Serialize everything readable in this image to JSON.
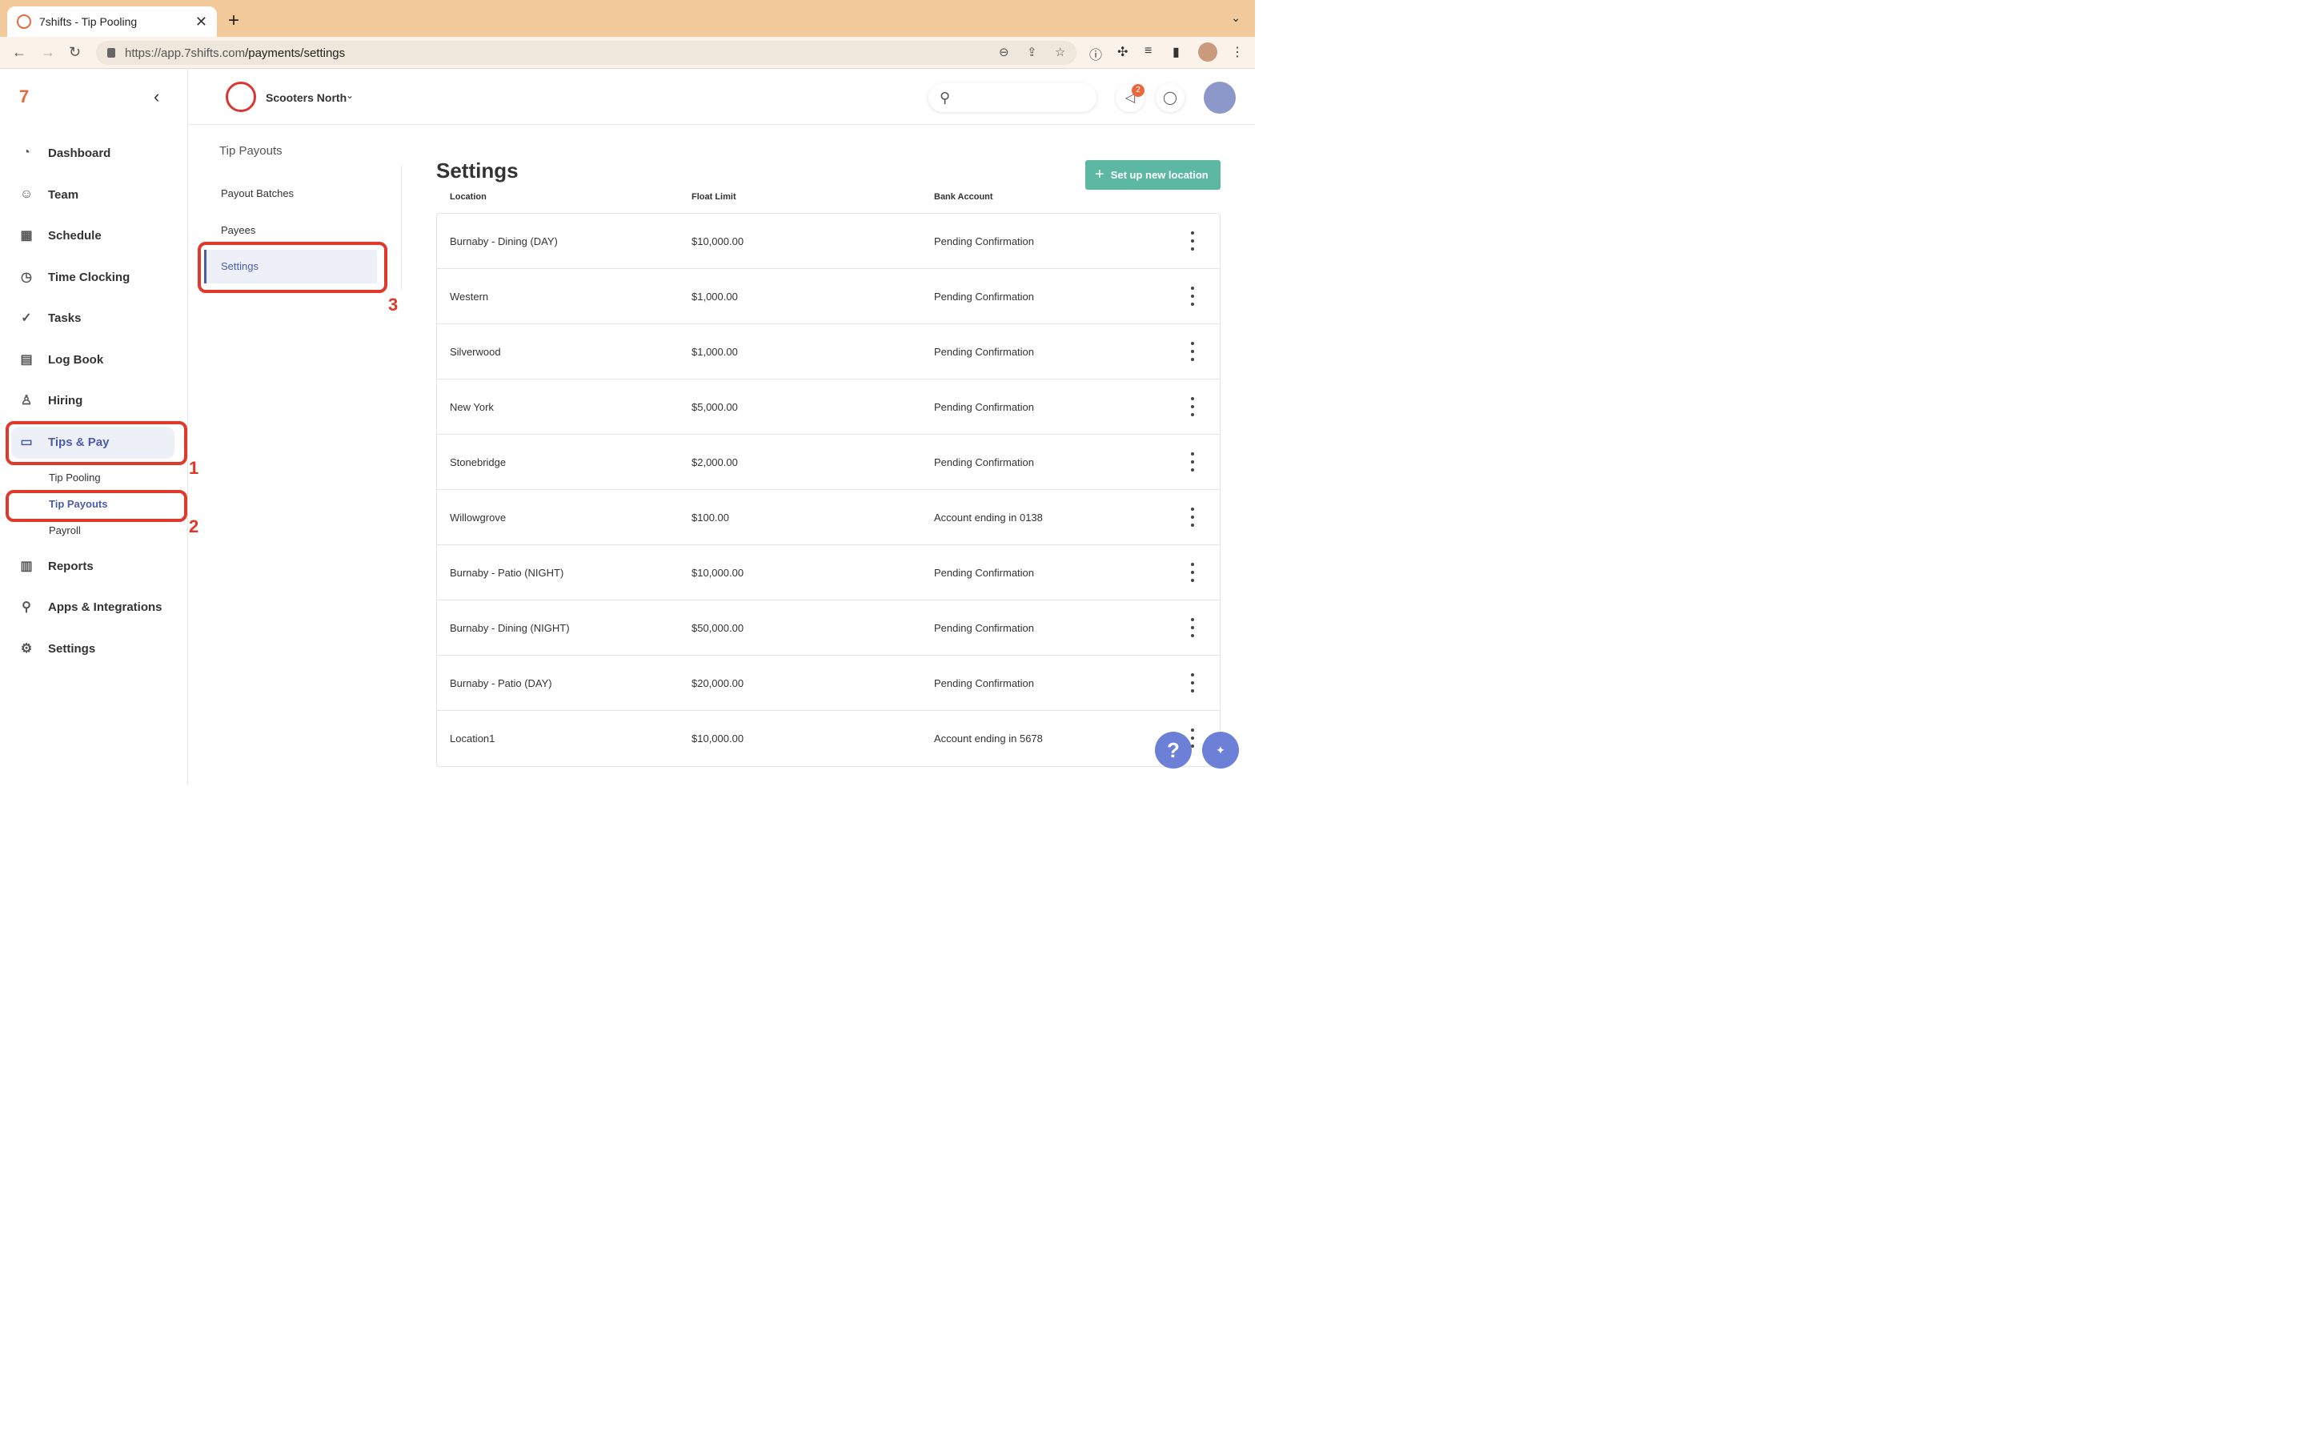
{
  "browser": {
    "tab_title": "7shifts - Tip Pooling",
    "new_tab": "+",
    "url_host": "https://app.7shifts.com",
    "url_path": "/payments/settings"
  },
  "sidebar": {
    "items": [
      {
        "label": "Dashboard",
        "icon": "dashboard-icon"
      },
      {
        "label": "Team",
        "icon": "team-icon"
      },
      {
        "label": "Schedule",
        "icon": "schedule-icon"
      },
      {
        "label": "Time Clocking",
        "icon": "time-clocking-icon"
      },
      {
        "label": "Tasks",
        "icon": "tasks-icon"
      },
      {
        "label": "Log Book",
        "icon": "log-book-icon"
      },
      {
        "label": "Hiring",
        "icon": "hiring-icon"
      },
      {
        "label": "Tips & Pay",
        "icon": "tips-pay-icon"
      },
      {
        "label": "Reports",
        "icon": "reports-icon"
      },
      {
        "label": "Apps & Integrations",
        "icon": "apps-integrations-icon"
      },
      {
        "label": "Settings",
        "icon": "settings-icon"
      }
    ],
    "sub_items": [
      "Tip Pooling",
      "Tip Payouts",
      "Payroll"
    ]
  },
  "topbar": {
    "location": "Scooters North",
    "notification_count": "2"
  },
  "subpanel": {
    "title": "Tip Payouts",
    "items": [
      "Payout Batches",
      "Payees",
      "Settings"
    ]
  },
  "annotations": [
    "1",
    "2",
    "3"
  ],
  "main": {
    "title": "Settings",
    "setup_button": "Set up new location",
    "columns": [
      "Location",
      "Float Limit",
      "Bank Account"
    ],
    "rows": [
      {
        "location": "Burnaby - Dining (DAY)",
        "float": "$10,000.00",
        "bank": "Pending Confirmation"
      },
      {
        "location": "Western",
        "float": "$1,000.00",
        "bank": "Pending Confirmation"
      },
      {
        "location": "Silverwood",
        "float": "$1,000.00",
        "bank": "Pending Confirmation"
      },
      {
        "location": "New York",
        "float": "$5,000.00",
        "bank": "Pending Confirmation"
      },
      {
        "location": "Stonebridge",
        "float": "$2,000.00",
        "bank": "Pending Confirmation"
      },
      {
        "location": "Willowgrove",
        "float": "$100.00",
        "bank": "Account ending in 0138"
      },
      {
        "location": "Burnaby - Patio (NIGHT)",
        "float": "$10,000.00",
        "bank": "Pending Confirmation"
      },
      {
        "location": "Burnaby - Dining (NIGHT)",
        "float": "$50,000.00",
        "bank": "Pending Confirmation"
      },
      {
        "location": "Burnaby - Patio (DAY)",
        "float": "$20,000.00",
        "bank": "Pending Confirmation"
      },
      {
        "location": "Location1",
        "float": "$10,000.00",
        "bank": "Account ending in 5678"
      }
    ]
  },
  "help_label": "?",
  "colors": {
    "accent": "#4a5cab",
    "teal": "#5cb8a3",
    "annotation": "#e0392b"
  }
}
